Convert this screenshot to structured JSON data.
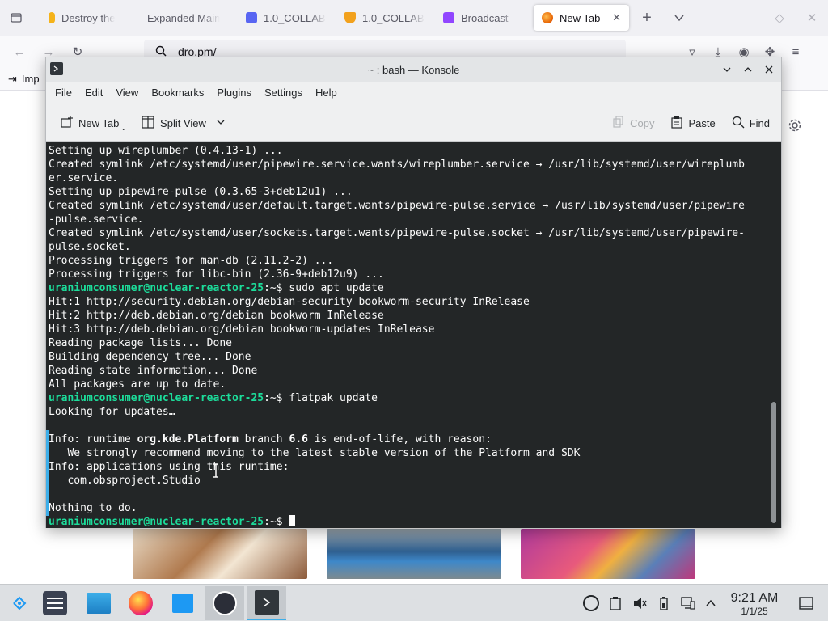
{
  "browser": {
    "tabs": [
      {
        "label": "Destroy the",
        "favicon_color": "#f5b31a"
      },
      {
        "label": "Expanded Main",
        "favicon_color": ""
      },
      {
        "label": "1.0_COLLAB",
        "favicon_color": "#5865f2"
      },
      {
        "label": "1.0_COLLAB",
        "favicon_color": "#f2a11d"
      },
      {
        "label": "Broadcast -",
        "favicon_color": "#9146ff"
      },
      {
        "label": "New Tab",
        "favicon_color": "#e66000"
      }
    ],
    "url": "dro.pm/",
    "bookmark_label": "Imp"
  },
  "konsole": {
    "title": "~ : bash — Konsole",
    "menu": [
      "File",
      "Edit",
      "View",
      "Bookmarks",
      "Plugins",
      "Settings",
      "Help"
    ],
    "toolbar": {
      "new_tab": "New Tab",
      "split_view": "Split View",
      "copy": "Copy",
      "paste": "Paste",
      "find": "Find"
    },
    "prompt": "uraniumconsumer@nuclear-reactor-25",
    "prompt_suffix": ":~$ ",
    "lines": [
      {
        "text": "Setting up wireplumber (0.4.13-1) ..."
      },
      {
        "text": "Created symlink /etc/systemd/user/pipewire.service.wants/wireplumber.service → /usr/lib/systemd/user/wireplumb"
      },
      {
        "text": "er.service."
      },
      {
        "text": "Setting up pipewire-pulse (0.3.65-3+deb12u1) ..."
      },
      {
        "text": "Created symlink /etc/systemd/user/default.target.wants/pipewire-pulse.service → /usr/lib/systemd/user/pipewire"
      },
      {
        "text": "-pulse.service."
      },
      {
        "text": "Created symlink /etc/systemd/user/sockets.target.wants/pipewire-pulse.socket → /usr/lib/systemd/user/pipewire-"
      },
      {
        "text": "pulse.socket."
      },
      {
        "text": "Processing triggers for man-db (2.11.2-2) ..."
      },
      {
        "text": "Processing triggers for libc-bin (2.36-9+deb12u9) ..."
      },
      {
        "prompt": true,
        "command": "sudo apt update"
      },
      {
        "text": "Hit:1 http://security.debian.org/debian-security bookworm-security InRelease"
      },
      {
        "text": "Hit:2 http://deb.debian.org/debian bookworm InRelease"
      },
      {
        "text": "Hit:3 http://deb.debian.org/debian bookworm-updates InRelease"
      },
      {
        "text": "Reading package lists... Done"
      },
      {
        "text": "Building dependency tree... Done"
      },
      {
        "text": "Reading state information... Done"
      },
      {
        "text": "All packages are up to date."
      },
      {
        "prompt": true,
        "command": "flatpak update"
      },
      {
        "text": "Looking for updates…"
      },
      {
        "text": ""
      },
      {
        "parts": [
          {
            "t": "Info: runtime "
          },
          {
            "t": "org.kde.Platform",
            "b": true
          },
          {
            "t": " branch "
          },
          {
            "t": "6.6",
            "b": true
          },
          {
            "t": " is end-of-life, with reason:"
          }
        ]
      },
      {
        "text": "   We strongly recommend moving to the latest stable version of the Platform and SDK"
      },
      {
        "text": "Info: applications using this runtime:"
      },
      {
        "text": "   com.obsproject.Studio"
      },
      {
        "text": ""
      },
      {
        "text": "Nothing to do."
      },
      {
        "prompt": true,
        "command": "",
        "cursor": true
      }
    ]
  },
  "taskbar": {
    "clock_time": "9:21 AM",
    "clock_date": "1/1/25"
  },
  "colors": {
    "terminal_bg": "#232627",
    "terminal_fg": "#fcfcfc",
    "prompt_green": "#1cdc9a",
    "accent_blue": "#3daee9"
  }
}
